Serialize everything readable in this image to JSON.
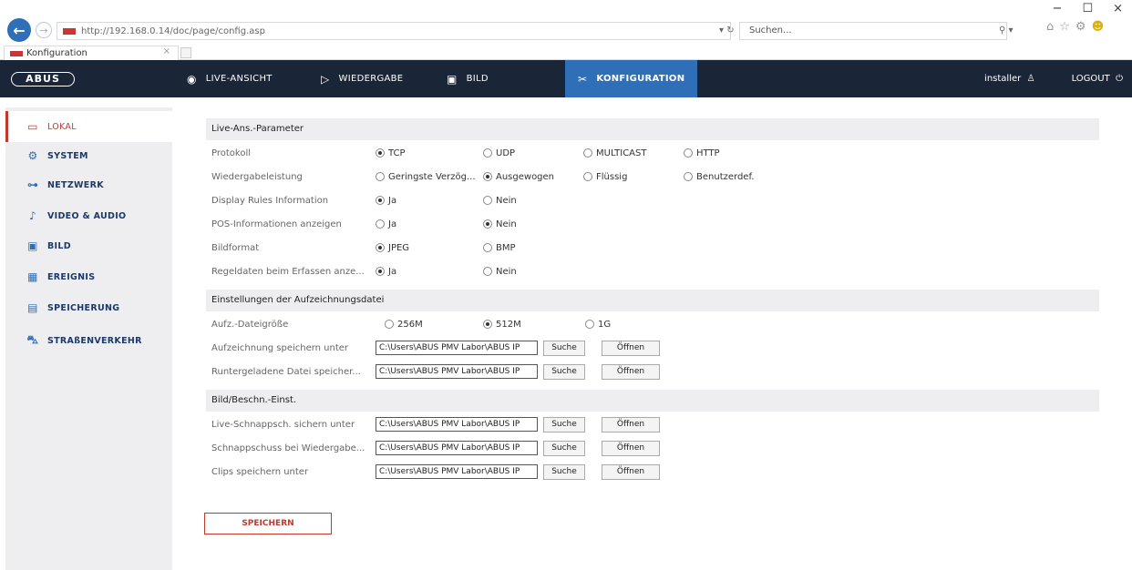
{
  "browser": {
    "url": "http://192.168.0.14/doc/page/config.asp",
    "address_tools": "▾ ↻",
    "search_placeholder": "Suchen...",
    "search_tools": "⚲ ▾",
    "tab_title": "Konfiguration",
    "tab_close": "×",
    "minimize": "−",
    "maximize": "☐",
    "close": "×"
  },
  "app": {
    "logo": "ABUS",
    "nav": {
      "live": "LIVE-ANSICHT",
      "playback": "WIEDERGABE",
      "image": "BILD",
      "config": "KONFIGURATION"
    },
    "user": "installer",
    "logout": "LOGOUT"
  },
  "sidebar": {
    "items": [
      {
        "label": "LOKAL",
        "icon": "monitor-icon"
      },
      {
        "label": "SYSTEM",
        "icon": "system-icon"
      },
      {
        "label": "NETZWERK",
        "icon": "network-icon"
      },
      {
        "label": "VIDEO & AUDIO",
        "icon": "microphone-icon"
      },
      {
        "label": "BILD",
        "icon": "image-icon"
      },
      {
        "label": "EREIGNIS",
        "icon": "calendar-icon"
      },
      {
        "label": "SPEICHERUNG",
        "icon": "storage-icon"
      },
      {
        "label": "STRAßENVERKEHR",
        "icon": "traffic-icon"
      }
    ]
  },
  "live_params": {
    "title": "Live-Ans.-Parameter",
    "protocol": {
      "label": "Protokoll",
      "options": [
        "TCP",
        "UDP",
        "MULTICAST",
        "HTTP"
      ],
      "selected": "TCP"
    },
    "performance": {
      "label": "Wiedergabeleistung",
      "options": [
        "Geringste Verzög...",
        "Ausgewogen",
        "Flüssig",
        "Benutzerdef."
      ],
      "selected": "Ausgewogen"
    },
    "rules": {
      "label": "Display Rules Information",
      "options": [
        "Ja",
        "Nein"
      ],
      "selected": "Ja"
    },
    "pos": {
      "label": "POS-Informationen anzeigen",
      "options": [
        "Ja",
        "Nein"
      ],
      "selected": "Nein"
    },
    "format": {
      "label": "Bildformat",
      "options": [
        "JPEG",
        "BMP"
      ],
      "selected": "JPEG"
    },
    "rule_data": {
      "label": "Regeldaten beim Erfassen anze...",
      "options": [
        "Ja",
        "Nein"
      ],
      "selected": "Ja"
    }
  },
  "record_settings": {
    "title": "Einstellungen der Aufzeichnungsdatei",
    "filesize": {
      "label": "Aufz.-Dateigröße",
      "options": [
        "256M",
        "512M",
        "1G"
      ],
      "selected": "512M"
    },
    "save_record": {
      "label": "Aufzeichnung speichern unter",
      "path": "C:\\Users\\ABUS PMV Labor\\ABUS IP",
      "browse": "Suche",
      "open": "Öffnen"
    },
    "save_download": {
      "label": "Runtergeladene Datei speicher...",
      "path": "C:\\Users\\ABUS PMV Labor\\ABUS IP",
      "browse": "Suche",
      "open": "Öffnen"
    }
  },
  "image_settings": {
    "title": "Bild/Beschn.-Einst.",
    "live_snap": {
      "label": "Live-Schnappsch. sichern unter",
      "path": "C:\\Users\\ABUS PMV Labor\\ABUS IP",
      "browse": "Suche",
      "open": "Öffnen"
    },
    "playback_snap": {
      "label": "Schnappschuss bei Wiedergabe...",
      "path": "C:\\Users\\ABUS PMV Labor\\ABUS IP",
      "browse": "Suche",
      "open": "Öffnen"
    },
    "clips": {
      "label": "Clips speichern unter",
      "path": "C:\\Users\\ABUS PMV Labor\\ABUS IP",
      "browse": "Suche",
      "open": "Öffnen"
    }
  },
  "save_label": "SPEICHERN",
  "colors": {
    "navbar": "#1b2538",
    "accent": "#2f6fb7",
    "active_red": "#c0392b"
  }
}
